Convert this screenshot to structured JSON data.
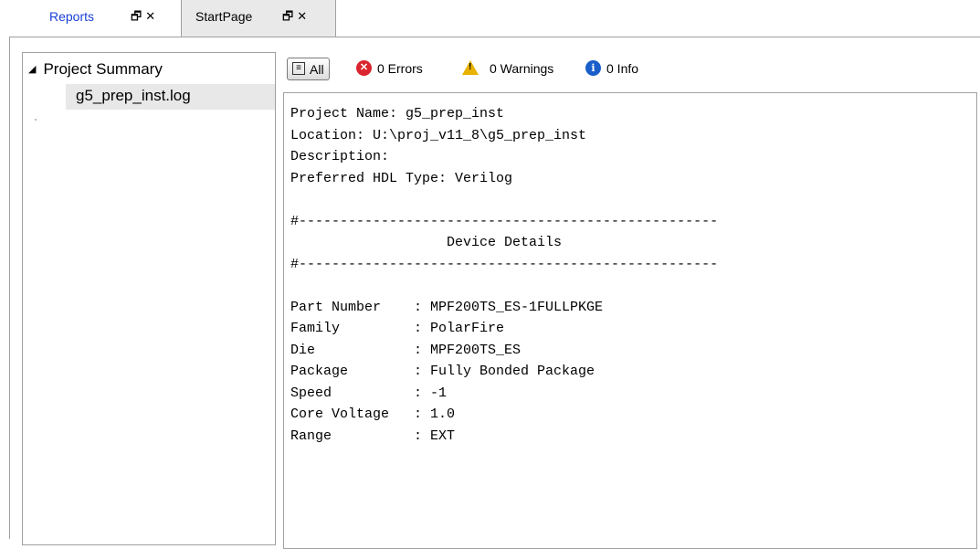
{
  "tabs": [
    {
      "label": "Reports",
      "pin_icon": "restore-window-icon",
      "close": "✕"
    },
    {
      "label": "StartPage",
      "pin_icon": "restore-window-icon",
      "close": "✕"
    }
  ],
  "tree": {
    "root": "Project Summary",
    "children": [
      "g5_prep_inst.log"
    ]
  },
  "filter": {
    "all": "All",
    "errors": "0 Errors",
    "warnings": "0 Warnings",
    "info": "0 Info"
  },
  "log": {
    "lines": [
      "Project Name: g5_prep_inst",
      "Location: U:\\proj_v11_8\\g5_prep_inst",
      "Description:",
      "Preferred HDL Type: Verilog",
      "",
      "#---------------------------------------------------",
      "                   Device Details",
      "#---------------------------------------------------",
      "",
      "Part Number    : MPF200TS_ES-1FULLPKGE",
      "Family         : PolarFire",
      "Die            : MPF200TS_ES",
      "Package        : Fully Bonded Package",
      "Speed          : -1",
      "Core Voltage   : 1.0",
      "Range          : EXT"
    ]
  },
  "colors": {
    "active_tab_text": "#1a3fd6",
    "error": "#d9262e",
    "warning": "#e9b200",
    "info": "#1a5ec9"
  }
}
